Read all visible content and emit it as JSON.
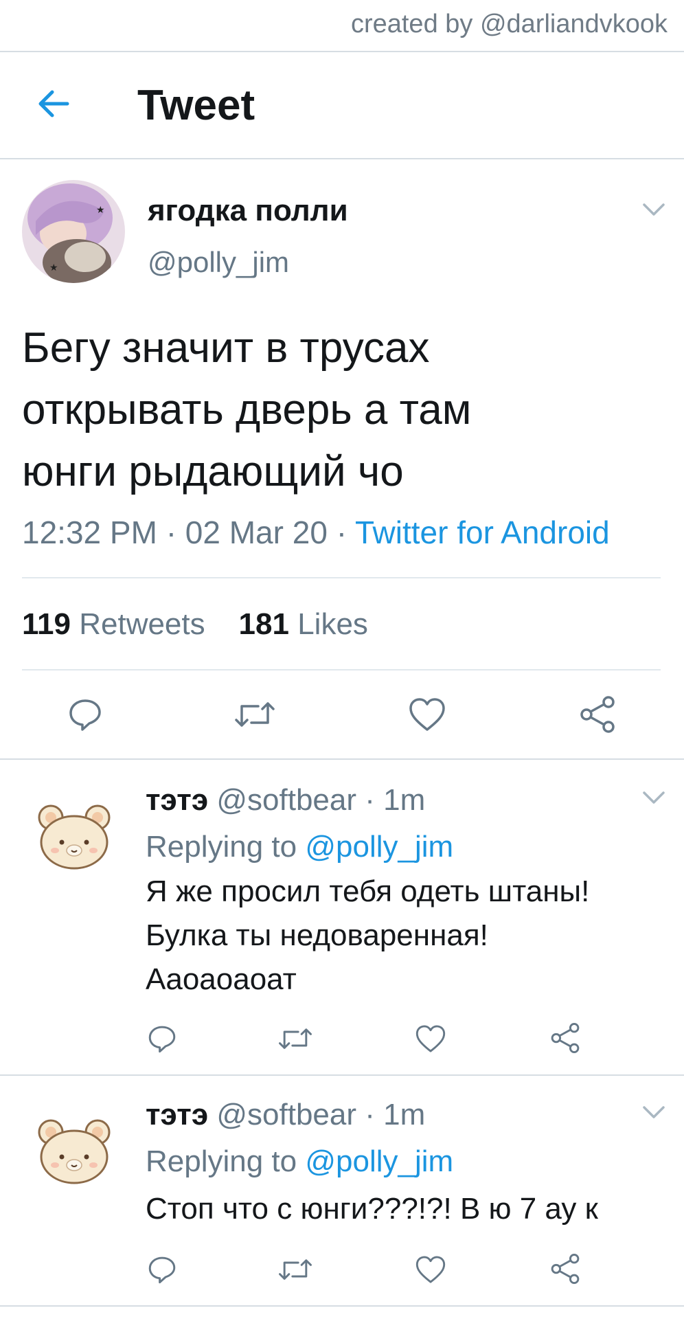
{
  "watermark": "created by @darliandvkook",
  "header": {
    "title": "Tweet",
    "back_icon": "arrow-left-icon"
  },
  "tweet": {
    "author_name": "ягодка полли",
    "author_handle": "@polly_jim",
    "text_lines": [
      "Бегу значит в трусах",
      "открывать дверь а там",
      "юнги рыдающий чо"
    ],
    "time": "12:32 PM",
    "date": "02 Mar 20",
    "source": "Twitter for Android",
    "separator": "·",
    "retweets_count": "119",
    "retweets_label": "Retweets",
    "likes_count": "181",
    "likes_label": "Likes",
    "actions": [
      "reply-icon",
      "retweet-icon",
      "like-icon",
      "share-icon"
    ]
  },
  "replies": [
    {
      "name": "тэтэ",
      "handle": "@softbear",
      "sep": "·",
      "time": "1m",
      "replying_prefix": "Replying to",
      "replying_to": "@polly_jim",
      "text_lines": [
        "Я же просил тебя одеть штаны!",
        "Булка ты недоваренная!",
        "Аaoaoaoат"
      ]
    },
    {
      "name": "тэтэ",
      "handle": "@softbear",
      "sep": "·",
      "time": "1m",
      "replying_prefix": "Replying to",
      "replying_to": "@polly_jim",
      "text_lines": [
        "Стоп что с юнги???!?! В ю 7 ау к"
      ]
    }
  ],
  "colors": {
    "accent": "#1b95e0",
    "secondary_text": "#657786",
    "divider": "#e1e8ed"
  }
}
